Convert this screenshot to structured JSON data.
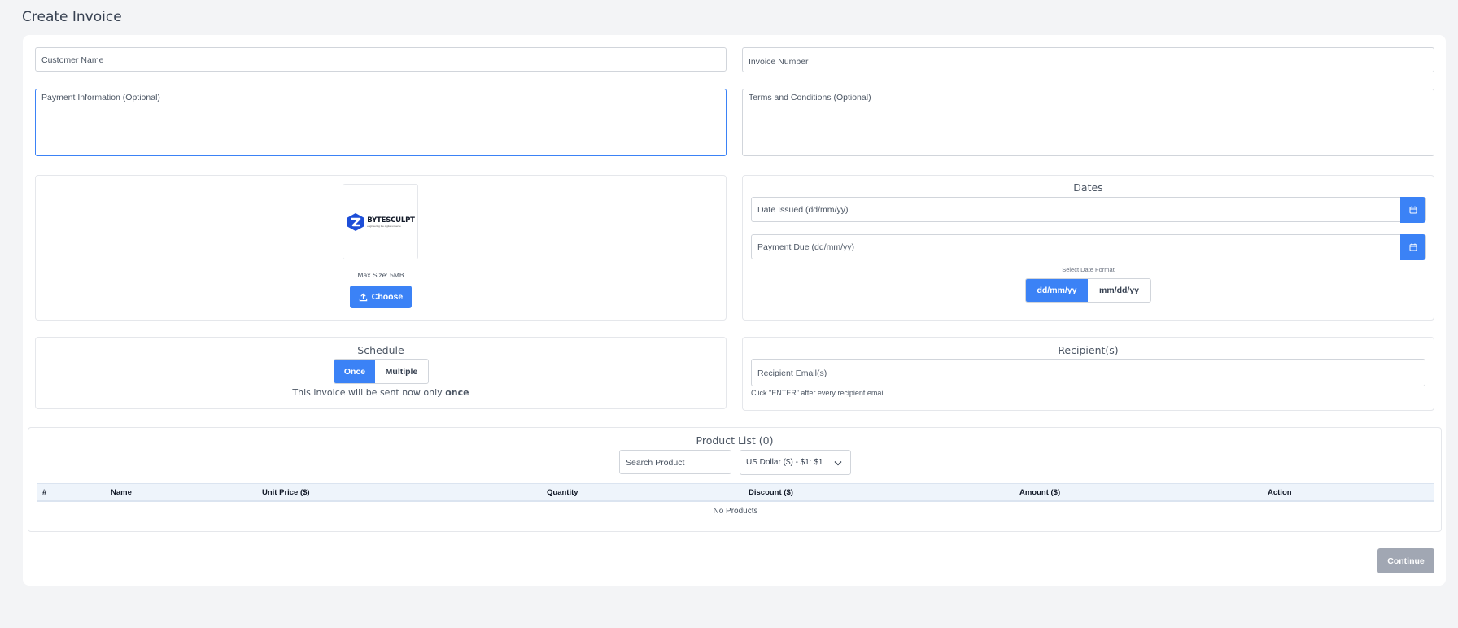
{
  "page": {
    "title": "Create Invoice"
  },
  "fields": {
    "customer_name": {
      "placeholder": "Customer Name"
    },
    "invoice_number": {
      "placeholder": "Invoice Number"
    },
    "payment_info": {
      "placeholder": "Payment Information (Optional)"
    },
    "terms": {
      "placeholder": "Terms and Conditions (Optional)"
    }
  },
  "logo": {
    "brand": "BYTESCULPT",
    "tagline": "engineering the digital universe",
    "max_size": "Max Size: 5MB",
    "choose_label": "Choose"
  },
  "dates": {
    "title": "Dates",
    "date_issued_placeholder": "Date Issued (dd/mm/yy)",
    "payment_due_placeholder": "Payment Due (dd/mm/yy)",
    "format_label": "Select Date Format",
    "formats": [
      "dd/mm/yy",
      "mm/dd/yy"
    ],
    "selected_format": "dd/mm/yy"
  },
  "schedule": {
    "title": "Schedule",
    "options": [
      "Once",
      "Multiple"
    ],
    "selected": "Once",
    "note_prefix": "This invoice will be sent now only",
    "note_bold": "once"
  },
  "recipients": {
    "title": "Recipient(s)",
    "placeholder": "Recipient Email(s)",
    "hint": "Click \"ENTER\" after every recipient email"
  },
  "products": {
    "title": "Product List (0)",
    "search_placeholder": "Search Product",
    "currency": "US Dollar ($) - $1: $1",
    "columns": [
      "#",
      "Name",
      "Unit Price ($)",
      "Quantity",
      "Discount ($)",
      "Amount ($)",
      "Action"
    ],
    "empty_text": "No Products"
  },
  "actions": {
    "continue_label": "Continue"
  },
  "colors": {
    "primary": "#3b82f6",
    "disabled": "#a1a7b3",
    "focus_border": "#3b82f6"
  },
  "icons": [
    "upload-icon",
    "calendar-icon",
    "chevron-down-icon"
  ]
}
